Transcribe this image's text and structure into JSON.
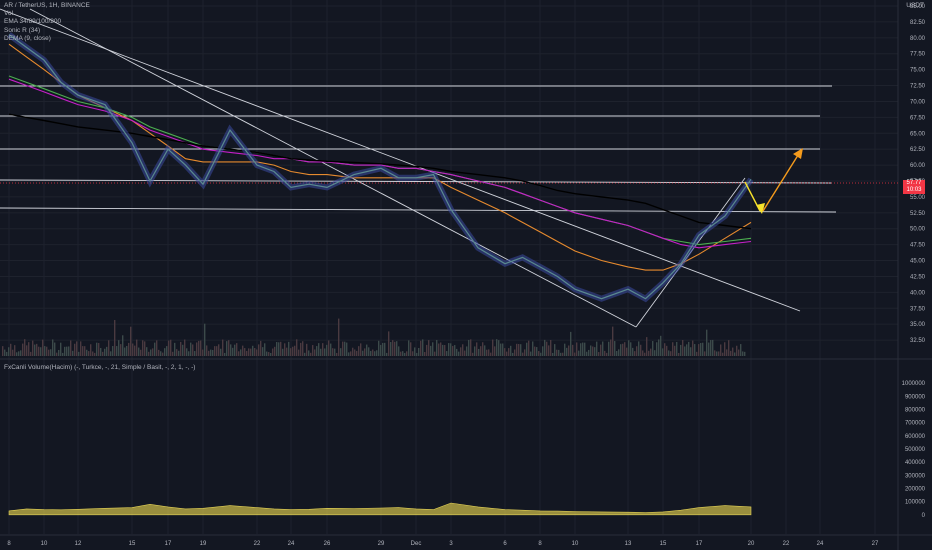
{
  "legend": {
    "symbol": "AR / TetherUS, 1H, BINANCE",
    "vol": "Vol",
    "ema": "EMA 34/89/100/200",
    "sonic": "Sonic R (34)",
    "dema": "DEMA (9, close)"
  },
  "indicator_title": "FxCanli Volume(Hacim) (-, Turkce, -, 21, Simple / Basit, -, 2, 1, -, -)",
  "currency": "USDT",
  "price_tag": {
    "price": "57.77",
    "time": "10:03"
  },
  "colors": {
    "background": "#131722",
    "price_line": "#f23645",
    "yellow_arrow": "#f7e22b",
    "orange_arrow": "#f59b1c",
    "ema_purple": "#c51fc8",
    "volume_osc": "#d3c24a"
  },
  "chart_data": [
    {
      "type": "line",
      "title": "AR / TetherUS, 1H, BINANCE",
      "ylabel": "USDT",
      "ylim": [
        30.0,
        85.0
      ],
      "y_ticks": [
        32.5,
        35.0,
        37.5,
        40.0,
        42.5,
        45.0,
        47.5,
        50.0,
        52.5,
        55.0,
        57.5,
        60.0,
        62.5,
        65.0,
        67.5,
        70.0,
        72.5,
        75.0,
        77.5,
        80.0,
        82.5,
        85.0
      ],
      "x_ticks": [
        "8",
        "10",
        "12",
        "15",
        "17",
        "19",
        "22",
        "24",
        "26",
        "29",
        "Dec",
        "3",
        "6",
        "8",
        "10",
        "13",
        "15",
        "17",
        "20",
        "22",
        "24",
        "27"
      ],
      "x_tick_index": [
        0,
        2,
        4,
        6,
        8,
        10,
        12,
        14,
        16,
        18,
        20,
        22,
        24,
        26,
        28,
        30,
        32,
        34,
        36,
        38,
        40,
        42
      ],
      "series": [
        {
          "x_index": [
            0,
            1,
            2,
            3,
            4,
            5,
            6,
            7,
            8,
            9,
            10,
            11,
            12,
            13,
            14,
            15,
            16,
            17,
            18,
            19,
            20,
            21,
            22,
            23,
            24,
            25,
            26,
            27,
            28,
            29,
            30,
            31,
            32,
            33,
            34,
            35,
            36
          ],
          "values": [
            80.5,
            78.5,
            76.5,
            73.0,
            71.0,
            69.5,
            63.5,
            57.5,
            62.5,
            60.0,
            57.0,
            65.5,
            60.0,
            59.0,
            56.5,
            57.0,
            56.5,
            58.5,
            59.5,
            58.0,
            58.0,
            58.5,
            53.0,
            47.0,
            44.5,
            45.5,
            44.0,
            42.5,
            40.5,
            39.0,
            40.5,
            39.0,
            41.5,
            44.5,
            49.0,
            52.0,
            57.77
          ]
        },
        {
          "name": "EMA 34",
          "values": [
            79.0,
            77.0,
            75.0,
            73.0,
            71.0,
            69.0,
            67.0,
            65.0,
            63.0,
            61.0,
            60.5,
            60.5,
            60.5,
            60.0,
            59.0,
            58.5,
            58.5,
            58.0,
            58.0,
            58.0,
            58.0,
            58.0,
            56.5,
            54.5,
            52.5,
            51.0,
            49.5,
            48.0,
            46.5,
            45.0,
            44.0,
            43.5,
            43.5,
            44.5,
            46.0,
            48.5,
            51.0
          ]
        },
        {
          "name": "EMA 89",
          "values": [
            74.0,
            73.0,
            72.0,
            71.0,
            70.0,
            69.0,
            67.5,
            66.0,
            65.0,
            64.0,
            63.0,
            62.5,
            62.0,
            61.5,
            61.0,
            60.5,
            60.5,
            60.0,
            60.0,
            59.5,
            59.5,
            59.0,
            58.5,
            57.5,
            56.5,
            55.5,
            54.5,
            53.5,
            52.5,
            51.5,
            50.5,
            49.5,
            48.5,
            48.0,
            47.5,
            48.0,
            48.5
          ]
        },
        {
          "name": "EMA 100",
          "values": [
            73.5,
            72.5,
            71.5,
            70.5,
            69.5,
            68.5,
            67.0,
            65.5,
            64.5,
            63.5,
            62.5,
            62.0,
            61.5,
            61.0,
            61.0,
            60.5,
            60.5,
            60.0,
            60.0,
            59.5,
            59.5,
            59.0,
            58.5,
            57.5,
            56.5,
            55.5,
            54.5,
            53.5,
            52.5,
            51.5,
            50.5,
            49.5,
            48.5,
            47.5,
            47.0,
            47.5,
            48.0
          ]
        },
        {
          "name": "EMA 200",
          "values": [
            68.0,
            67.5,
            67.0,
            66.5,
            66.0,
            65.5,
            65.0,
            64.5,
            64.0,
            63.5,
            63.0,
            62.5,
            62.0,
            61.5,
            61.0,
            60.8,
            60.6,
            60.4,
            60.2,
            60.0,
            59.8,
            59.5,
            59.0,
            58.5,
            58.0,
            57.5,
            56.8,
            56.0,
            55.5,
            55.0,
            54.5,
            54.0,
            53.0,
            52.0,
            51.0,
            50.5,
            50.0
          ]
        }
      ]
    },
    {
      "type": "area",
      "title": "FxCanli Volume(Hacim)",
      "ylim": [
        -100000,
        1100000
      ],
      "y_ticks": [
        0,
        100000,
        200000,
        300000,
        400000,
        500000,
        600000,
        700000,
        800000,
        900000,
        1000000
      ],
      "values": [
        30000,
        45000,
        40000,
        38000,
        42000,
        50000,
        55000,
        80000,
        60000,
        45000,
        50000,
        70000,
        55000,
        45000,
        40000,
        42000,
        50000,
        48000,
        52000,
        55000,
        45000,
        40000,
        90000,
        60000,
        40000,
        35000,
        30000,
        28000,
        25000,
        22000,
        20000,
        18000,
        22000,
        35000,
        55000,
        70000,
        60000
      ]
    }
  ]
}
